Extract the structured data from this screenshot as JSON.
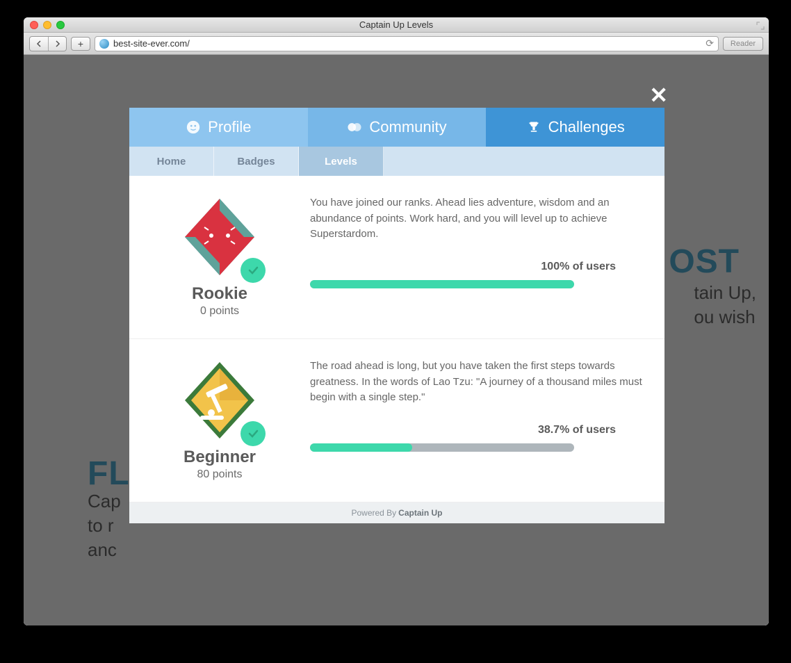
{
  "window": {
    "title": "Captain Up Levels",
    "url": "best-site-ever.com/",
    "reader_label": "Reader"
  },
  "background": {
    "left_heading_fragment": "FL",
    "left_body_fragments": [
      "Cap",
      "to r",
      "anc"
    ],
    "right_heading_fragment": "OST",
    "right_body_fragments": [
      "tain Up,",
      "ou wish"
    ]
  },
  "modal": {
    "main_tabs": {
      "profile": "Profile",
      "community": "Community",
      "challenges": "Challenges"
    },
    "sub_tabs": {
      "home": "Home",
      "badges": "Badges",
      "levels": "Levels"
    },
    "levels": [
      {
        "name": "Rookie",
        "points": "0 points",
        "description": "You have joined our ranks. Ahead lies adventure, wisdom and an abundance of points. Work hard, and you will level up to achieve Superstardom.",
        "progress_label": "100% of users",
        "progress_percent": 100
      },
      {
        "name": "Beginner",
        "points": "80 points",
        "description": "The road ahead is long, but you have taken the first steps towards greatness. In the words of Lao Tzu: \"A journey of a thousand miles must begin with a single step.\"",
        "progress_label": "38.7% of users",
        "progress_percent": 38.7
      }
    ],
    "footer": {
      "prefix": "Powered By",
      "brand": "Captain Up"
    }
  }
}
